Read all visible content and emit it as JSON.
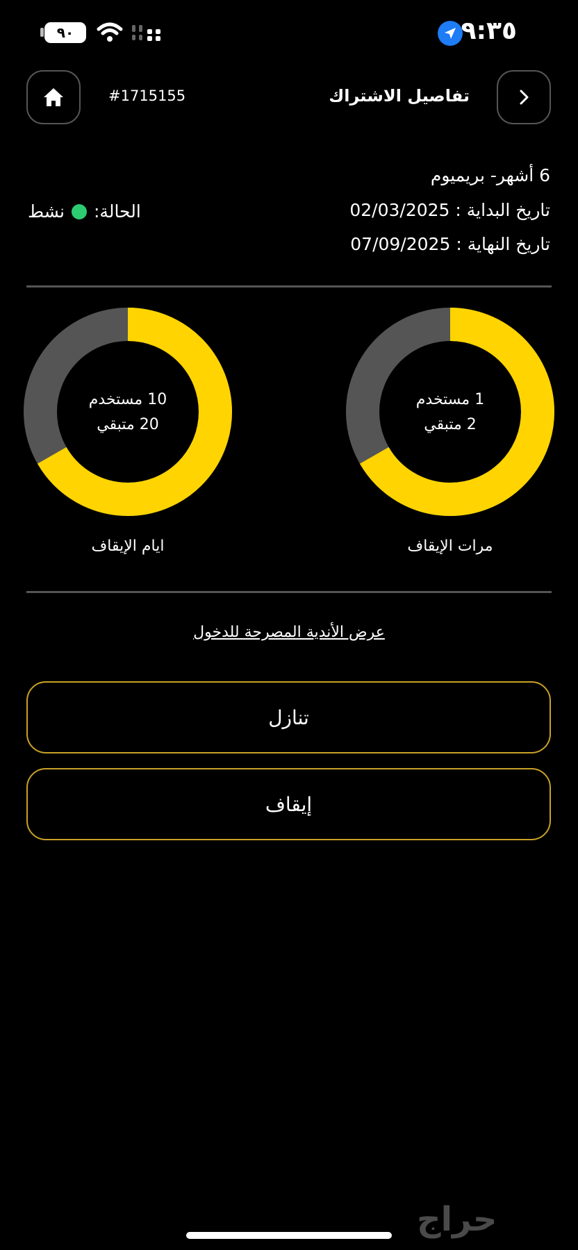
{
  "status_bar": {
    "time": "٩:٣٥",
    "battery": "٩٠"
  },
  "header": {
    "title": "تفاصيل الاشتراك",
    "order_id": "#1715155"
  },
  "subscription": {
    "plan": "6 أشهر- بريميوم",
    "start_date": "تاريخ البداية : 02/03/2025",
    "end_date": "تاريخ النهاية : 07/09/2025",
    "status_label": "الحالة:",
    "status_value": "نشط",
    "status_color": "#2ecc71"
  },
  "colors": {
    "accent": "#ffd400",
    "track": "#555555",
    "button_border": "#c9a227"
  },
  "charts": [
    {
      "label": "مرات الإيقاف",
      "used_text": "1 مستخدم",
      "remaining_text": "2 متبقي",
      "used": 1,
      "remaining": 2
    },
    {
      "label": "ايام الإيقاف",
      "used_text": "10 مستخدم",
      "remaining_text": "20 متبقي",
      "used": 10,
      "remaining": 20
    }
  ],
  "links": {
    "clubs": "عرض الأندية المصرحة للدخول"
  },
  "buttons": {
    "waive": "تنازل",
    "pause": "إيقاف"
  },
  "watermark": "حراج"
}
